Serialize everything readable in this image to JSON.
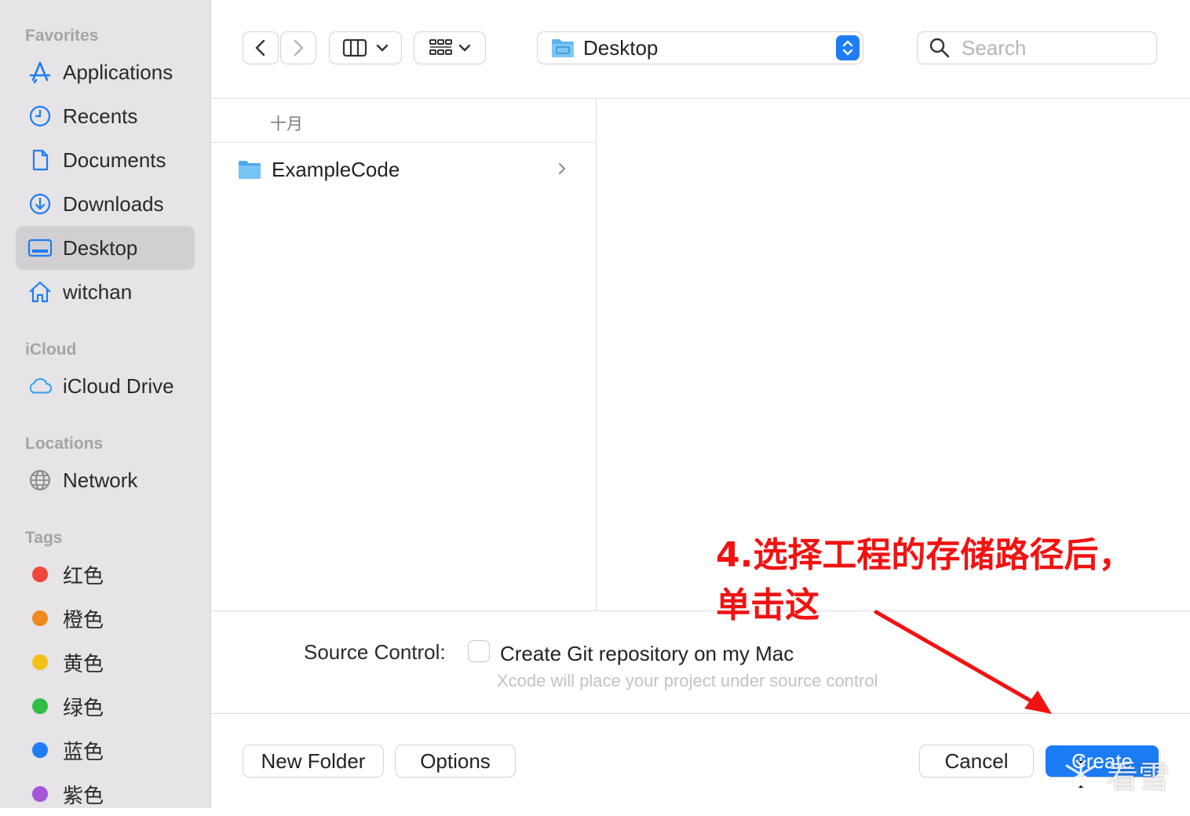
{
  "sidebar": {
    "favorites_title": "Favorites",
    "favorites": [
      {
        "label": "Applications",
        "icon": "applications-icon"
      },
      {
        "label": "Recents",
        "icon": "clock-icon"
      },
      {
        "label": "Documents",
        "icon": "document-icon"
      },
      {
        "label": "Downloads",
        "icon": "download-icon"
      },
      {
        "label": "Desktop",
        "icon": "desktop-icon",
        "selected": true
      },
      {
        "label": "witchan",
        "icon": "home-icon"
      }
    ],
    "icloud_title": "iCloud",
    "icloud": [
      {
        "label": "iCloud Drive",
        "icon": "cloud-icon"
      }
    ],
    "locations_title": "Locations",
    "locations": [
      {
        "label": "Network",
        "icon": "globe-icon"
      }
    ],
    "tags_title": "Tags",
    "tags": [
      {
        "label": "红色",
        "color": "#f0463c"
      },
      {
        "label": "橙色",
        "color": "#ef8a1f"
      },
      {
        "label": "黄色",
        "color": "#f3c21a"
      },
      {
        "label": "绿色",
        "color": "#2fbd45"
      },
      {
        "label": "蓝色",
        "color": "#1f7cf4"
      },
      {
        "label": "紫色",
        "color": "#a654d8"
      }
    ]
  },
  "toolbar": {
    "path_label": "Desktop",
    "search_placeholder": "Search"
  },
  "browser": {
    "group_header": "十月",
    "items": [
      {
        "label": "ExampleCode",
        "icon": "folder-icon"
      }
    ]
  },
  "options": {
    "source_control_label": "Source Control:",
    "git_checkbox_label": "Create Git repository on my Mac",
    "git_checked": false,
    "hint": "Xcode will place your project under source control"
  },
  "buttons": {
    "new_folder": "New Folder",
    "options": "Options",
    "cancel": "Cancel",
    "create": "Create"
  },
  "annotation": {
    "line1": "4.选择工程的存储路径后，",
    "line2": "单击这",
    "color": "#f21212"
  },
  "watermark": {
    "text": "看雪"
  },
  "colors": {
    "accent": "#1a7cf5",
    "sidebar_bg": "#e6e4e6"
  }
}
